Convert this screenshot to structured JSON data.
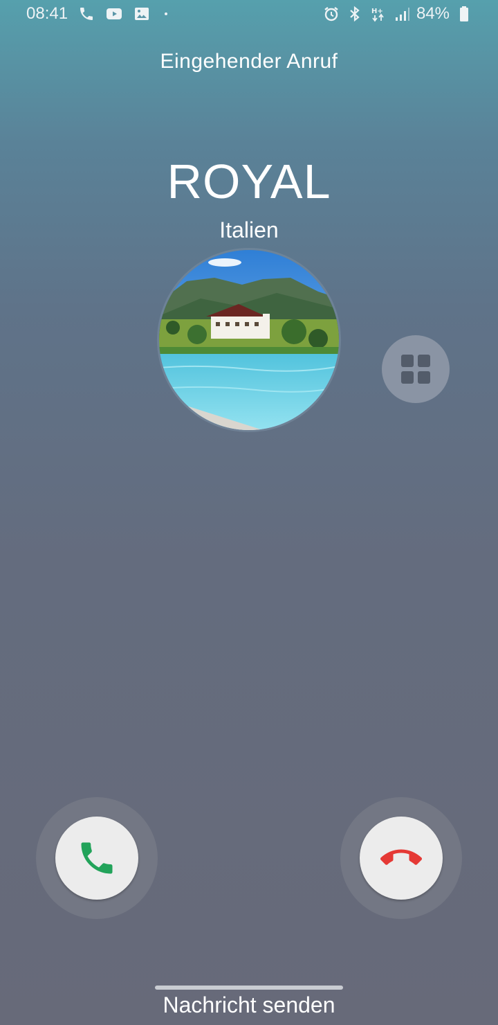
{
  "status_bar": {
    "time": "08:41",
    "left_icons": [
      "phone-icon",
      "youtube-icon",
      "gallery-icon"
    ],
    "right_icons": [
      "alarm-icon",
      "bluetooth-icon",
      "hplus-data-icon",
      "signal-icon",
      "battery-icon"
    ],
    "battery_percent": "84%"
  },
  "call": {
    "status": "Eingehender Anruf",
    "caller_name": "ROYAL",
    "caller_location": "Italien"
  },
  "actions": {
    "more_icon": "grid-icon",
    "accept_icon": "phone-accept-icon",
    "decline_icon": "phone-decline-icon",
    "accept_color": "#22a35a",
    "decline_color": "#e53935"
  },
  "footer": {
    "send_message": "Nachricht senden"
  }
}
